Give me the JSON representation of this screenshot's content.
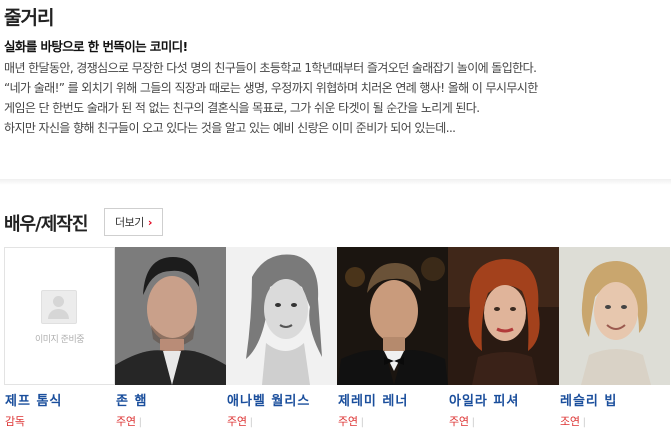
{
  "plot": {
    "title": "줄거리",
    "tagline": "실화를 바탕으로 한 번뜩이는 코미디!",
    "lines": [
      "매년 한달동안, 경쟁심으로 무장한 다섯 명의 친구들이 초등학교 1학년때부터 즐겨오던 술래잡기 놀이에 돌입한다.",
      " “네가 술래!” 를 외치기 위해 그들의 직장과 때로는 생명, 우정까지 위협하며 치러온 연례 행사! 올해 이 무시무시한",
      "게임은 단 한번도 술래가 된 적 없는 친구의 결혼식을 목표로, 그가 쉬운 타겟이 될 순간을 노리게 된다.",
      " 하지만 자신을 향해 친구들이 오고 있다는 것을 알고 있는 예비 신랑은 이미 준비가 되어 있는데..."
    ]
  },
  "cast": {
    "title": "배우/제작진",
    "more_label": "더보기",
    "more_icon": "chevron-right-icon",
    "placeholder_text": "이미지 준비중",
    "members": [
      {
        "name": "제프 톰식",
        "role": "감독"
      },
      {
        "name": "존 햄",
        "role": "주연"
      },
      {
        "name": "애나벨 월리스",
        "role": "주연"
      },
      {
        "name": "제레미 레너",
        "role": "주연"
      },
      {
        "name": "아일라 피셔",
        "role": "주연"
      },
      {
        "name": "레슬리 빕",
        "role": "조연"
      }
    ]
  },
  "colors": {
    "name": "#1a4e9c",
    "role": "#dd3333",
    "accent": "#e0001b"
  }
}
